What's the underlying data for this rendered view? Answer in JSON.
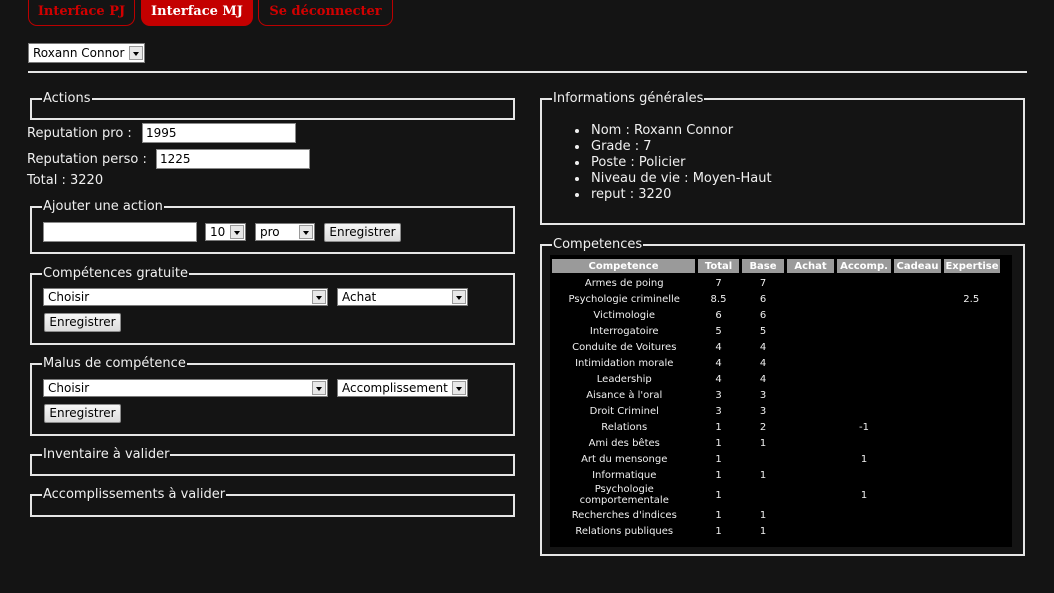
{
  "tabs": [
    {
      "label": "Interface PJ"
    },
    {
      "label": "Interface MJ"
    },
    {
      "label": "Se déconnecter"
    }
  ],
  "character_select": {
    "value": "Roxann Connor"
  },
  "actions": {
    "legend": "Actions",
    "rep_pro_label": "Reputation pro :",
    "rep_pro_value": "1995",
    "rep_perso_label": "Reputation perso :",
    "rep_perso_value": "1225",
    "total_label": "Total : 3220"
  },
  "ajouter_action": {
    "legend": "Ajouter une action",
    "text_value": "",
    "amount_value": "10",
    "type_value": "pro",
    "submit": "Enregistrer"
  },
  "competences_gratuite": {
    "legend": "Compétences gratuite",
    "skill_value": "Choisir",
    "mode_value": "Achat",
    "submit": "Enregistrer"
  },
  "malus": {
    "legend": "Malus de compétence",
    "skill_value": "Choisir",
    "mode_value": "Accomplissement",
    "submit": "Enregistrer"
  },
  "inventaire": {
    "legend": "Inventaire à valider"
  },
  "accomplissements": {
    "legend": "Accomplissements à valider"
  },
  "infos": {
    "legend": "Informations générales",
    "items": [
      "Nom : Roxann Connor",
      "Grade : 7",
      "Poste : Policier",
      "Niveau de vie : Moyen-Haut",
      "reput : 3220"
    ]
  },
  "competences": {
    "legend": "Competences",
    "headers": [
      "Competence",
      "Total",
      "Base",
      "Achat",
      "Accomp.",
      "Cadeau",
      "Expertise"
    ],
    "rows": [
      [
        "Armes de poing",
        "7",
        "7",
        "",
        "",
        "",
        ""
      ],
      [
        "Psychologie criminelle",
        "8.5",
        "6",
        "",
        "",
        "",
        "2.5"
      ],
      [
        "Victimologie",
        "6",
        "6",
        "",
        "",
        "",
        ""
      ],
      [
        "Interrogatoire",
        "5",
        "5",
        "",
        "",
        "",
        ""
      ],
      [
        "Conduite de Voitures",
        "4",
        "4",
        "",
        "",
        "",
        ""
      ],
      [
        "Intimidation morale",
        "4",
        "4",
        "",
        "",
        "",
        ""
      ],
      [
        "Leadership",
        "4",
        "4",
        "",
        "",
        "",
        ""
      ],
      [
        "Aisance à l'oral",
        "3",
        "3",
        "",
        "",
        "",
        ""
      ],
      [
        "Droit Criminel",
        "3",
        "3",
        "",
        "",
        "",
        ""
      ],
      [
        "Relations",
        "1",
        "2",
        "",
        "-1",
        "",
        ""
      ],
      [
        "Ami des bêtes",
        "1",
        "1",
        "",
        "",
        "",
        ""
      ],
      [
        "Art du mensonge",
        "1",
        "",
        "",
        "1",
        "",
        ""
      ],
      [
        "Informatique",
        "1",
        "1",
        "",
        "",
        "",
        ""
      ],
      [
        "Psychologie comportementale",
        "1",
        "",
        "",
        "1",
        "",
        ""
      ],
      [
        "Recherches d'indices",
        "1",
        "1",
        "",
        "",
        "",
        ""
      ],
      [
        "Relations publiques",
        "1",
        "1",
        "",
        "",
        "",
        ""
      ]
    ]
  }
}
